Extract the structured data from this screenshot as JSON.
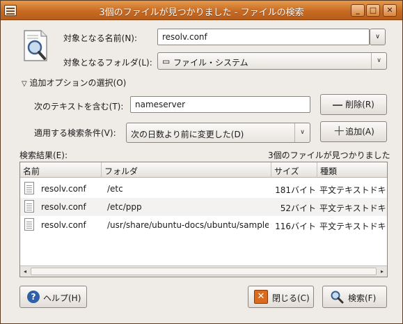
{
  "window": {
    "title": "3個のファイルが見つかりました - ファイルの検索",
    "min": "_",
    "max": "□",
    "close": "✕"
  },
  "form": {
    "name_label": "対象となる名前(N):",
    "name_value": "resolv.conf",
    "folder_label": "対象となるフォルダ(L):",
    "folder_value": "ファイル・システム",
    "options_toggle": "追加オプションの選択(O)",
    "text_label": "次のテキストを含む(T):",
    "text_value": "nameserver",
    "remove_label": "削除(R)",
    "condition_label": "適用する検索条件(V):",
    "condition_value": "次の日数より前に変更した(D)",
    "add_label": "追加(A)"
  },
  "results": {
    "label": "検索結果(E):",
    "summary": "3個のファイルが見つかりました",
    "columns": [
      "名前",
      "フォルダ",
      "サイズ",
      "種類"
    ],
    "rows": [
      {
        "name": "resolv.conf",
        "folder": "/etc",
        "size": "181バイト",
        "type": "平文テキストドキュメント"
      },
      {
        "name": "resolv.conf",
        "folder": "/etc/ppp",
        "size": "52バイト",
        "type": "平文テキストドキュメント"
      },
      {
        "name": "resolv.conf",
        "folder": "/usr/share/ubuntu-docs/ubuntu/sample",
        "size": "116バイト",
        "type": "平文テキストドキュメント"
      }
    ]
  },
  "footer": {
    "help_label": "ヘルプ(H)",
    "close_label": "閉じる(C)",
    "find_label": "検索(F)"
  }
}
